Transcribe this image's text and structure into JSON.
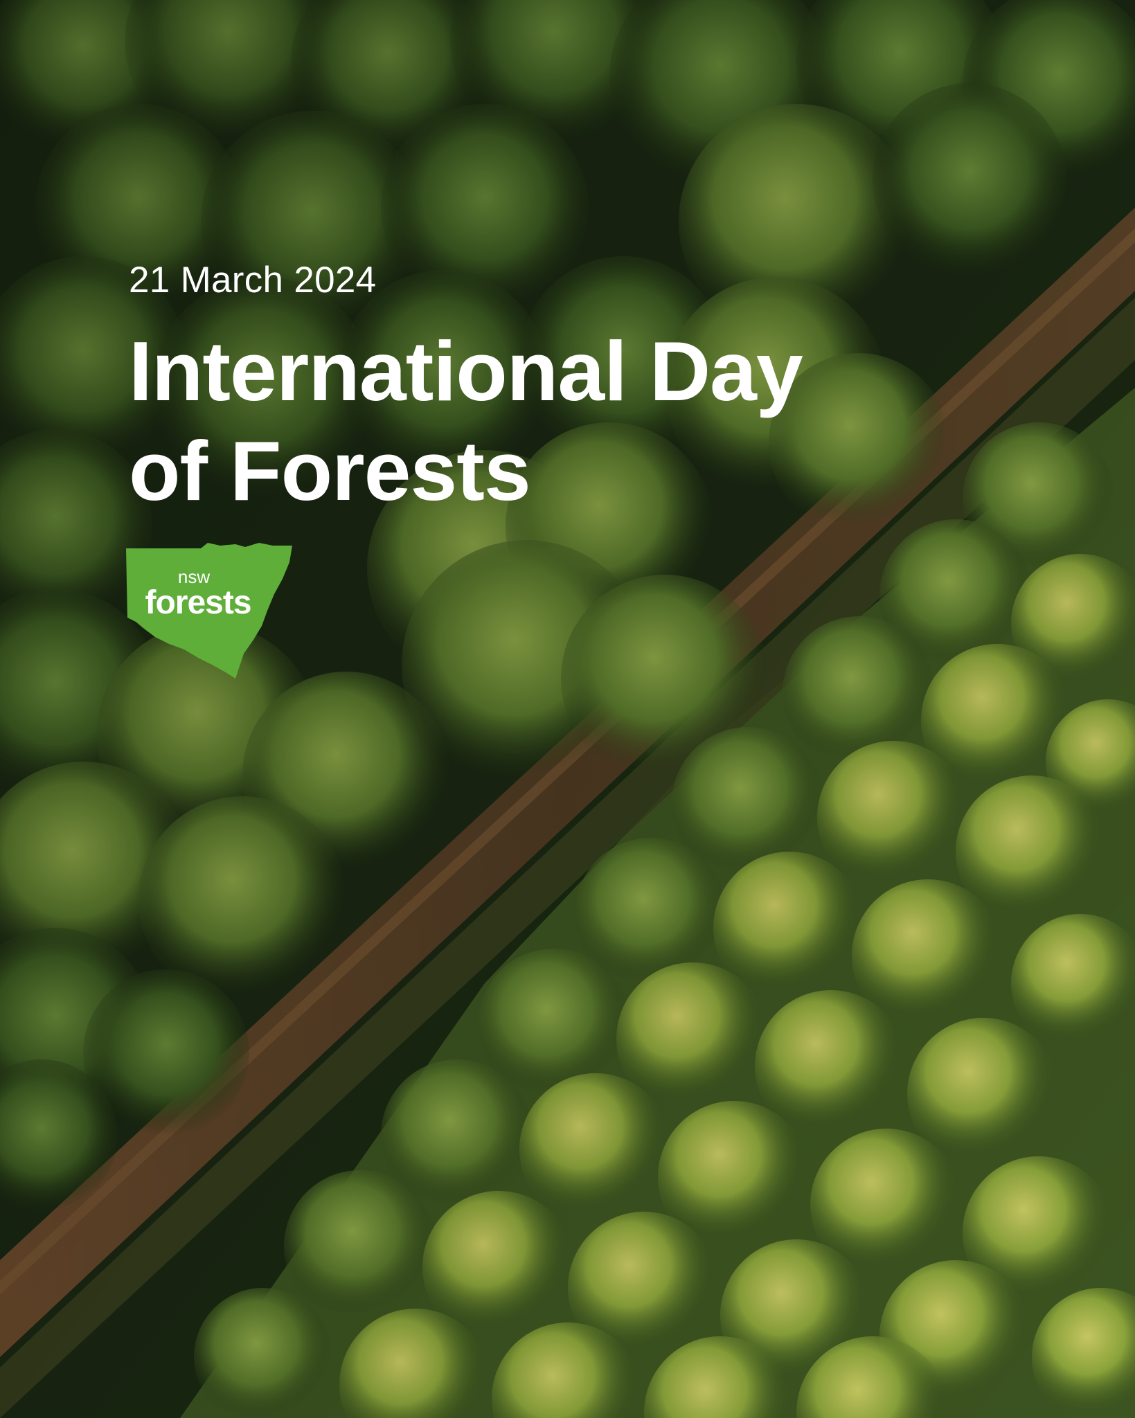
{
  "date": "21 March 2024",
  "title": {
    "line1": "International Day",
    "line2": "of Forests"
  },
  "logo": {
    "small": "nsw",
    "large": "forests",
    "shape": "nsw-state-map-icon",
    "color": "#5fae3a"
  },
  "colors": {
    "text": "#ffffff",
    "forest_dark": "#1a2a12",
    "road": "#5a4128"
  }
}
